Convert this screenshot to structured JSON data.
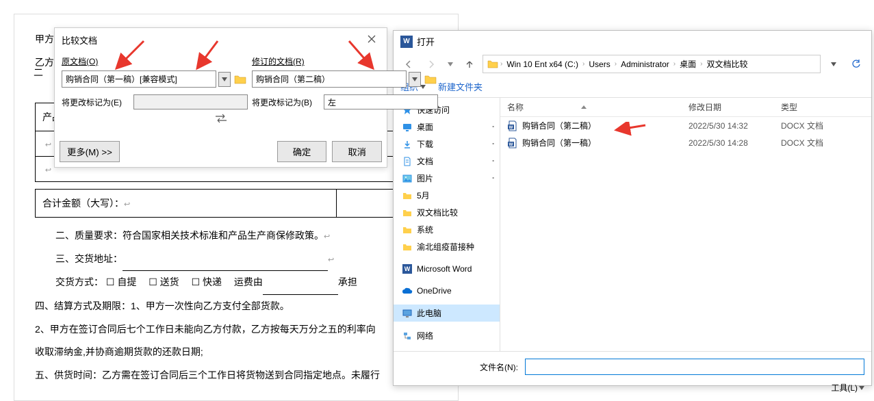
{
  "word_doc": {
    "line1": "甲方（需货方）：",
    "line2": "乙方",
    "line3": "二",
    "table_header": "产品名称",
    "table_cell1": "",
    "table_cell2": "",
    "total_label": "合计金额（大写）：",
    "para1": "二、质量要求：符合国家相关技术标准和产品生产商保修政策。",
    "para2_pre": "三、交货地址：",
    "para3_pre": "交货方式：",
    "checkbox1": "自提",
    "checkbox2": "送货",
    "checkbox3": "快递",
    "para3_mid": "　运费由",
    "para3_end": "承担",
    "para4": "四、结算方式及期限：1、甲方一次性向乙方支付全部货款。",
    "para5": "2、甲方在签订合同后七个工作日未能向乙方付款，乙方按每天万分之五的利率向",
    "para6": "收取滞纳金,并协商逾期货款的还款日期;",
    "para7": "五、供货时间：乙方需在签订合同后三个工作日将货物送到合同指定地点。未履行"
  },
  "compare_dialog": {
    "title": "比较文档",
    "col1_label": "原文档(O)",
    "col2_label": "修订的文档(R)",
    "doc1_value": "购销合同（第一稿）[兼容模式]",
    "doc2_value": "购销合同（第二稿）",
    "label1_text": "将更改标记为(E)",
    "label2_text": "将更改标记为(B)",
    "input1_value": "",
    "input2_value": "左",
    "more_button": "更多(M) >>",
    "ok_button": "确定",
    "cancel_button": "取消"
  },
  "open_dialog": {
    "title": "打开",
    "breadcrumb": [
      "Win 10 Ent x64 (C:)",
      "Users",
      "Administrator",
      "桌面",
      "双文档比较"
    ],
    "toolbar_organize": "组织",
    "toolbar_newfolder": "新建文件夹",
    "sidebar": [
      {
        "icon": "star",
        "label": "快速访问",
        "pin": false
      },
      {
        "icon": "desktop",
        "label": "桌面",
        "pin": true
      },
      {
        "icon": "download",
        "label": "下载",
        "pin": true
      },
      {
        "icon": "doc",
        "label": "文档",
        "pin": true
      },
      {
        "icon": "picture",
        "label": "图片",
        "pin": true
      },
      {
        "icon": "folder",
        "label": "5月",
        "pin": false
      },
      {
        "icon": "folder",
        "label": "双文档比较",
        "pin": false
      },
      {
        "icon": "folder",
        "label": "系统",
        "pin": false
      },
      {
        "icon": "folder",
        "label": "渝北组疫苗接种",
        "pin": false
      },
      {
        "icon": "word",
        "label": "Microsoft Word",
        "pin": false
      },
      {
        "icon": "onedrive",
        "label": "OneDrive",
        "pin": false
      },
      {
        "icon": "pc",
        "label": "此电脑",
        "pin": false,
        "selected": true
      },
      {
        "icon": "network",
        "label": "网络",
        "pin": false
      }
    ],
    "filelist_header": {
      "name": "名称",
      "date": "修改日期",
      "type": "类型"
    },
    "files": [
      {
        "name": "购销合同（第二稿）",
        "date": "2022/5/30 14:32",
        "type": "DOCX 文档"
      },
      {
        "name": "购销合同（第一稿）",
        "date": "2022/5/30 14:28",
        "type": "DOCX 文档"
      }
    ],
    "filename_label": "文件名(N):",
    "filename_value": "",
    "tools_label": "工具(L)"
  }
}
